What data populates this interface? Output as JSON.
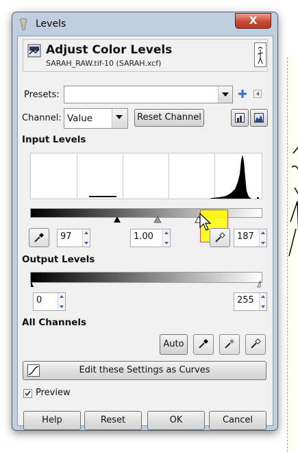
{
  "window": {
    "title": "Levels",
    "close_label": "X"
  },
  "header": {
    "title": "Adjust Color Levels",
    "subtitle": "SARAH_RAW.tif-10 (SARAH.xcf)"
  },
  "presets": {
    "label": "Presets:",
    "value": ""
  },
  "channel": {
    "label": "Channel:",
    "value": "Value",
    "reset_label": "Reset Channel"
  },
  "input_levels": {
    "heading": "Input Levels",
    "low": "97",
    "gamma": "1.00",
    "high": "187"
  },
  "output_levels": {
    "heading": "Output Levels",
    "low": "0",
    "high": "255"
  },
  "all_channels": {
    "heading": "All Channels",
    "auto_label": "Auto"
  },
  "curves_button": "Edit these Settings as Curves",
  "preview": {
    "label": "Preview",
    "checked": true
  },
  "buttons": {
    "help": "Help",
    "reset": "Reset",
    "ok": "OK",
    "cancel": "Cancel"
  },
  "colors": {
    "accent": "#3264b8",
    "highlight": "#ffff00",
    "close": "#c74a34"
  },
  "icons": [
    "levels-tool-icon",
    "add-icon",
    "menu-arrow-icon",
    "linear-histogram-icon",
    "log-histogram-icon",
    "color-picker-icon",
    "curves-icon",
    "mouse-cursor-icon"
  ]
}
